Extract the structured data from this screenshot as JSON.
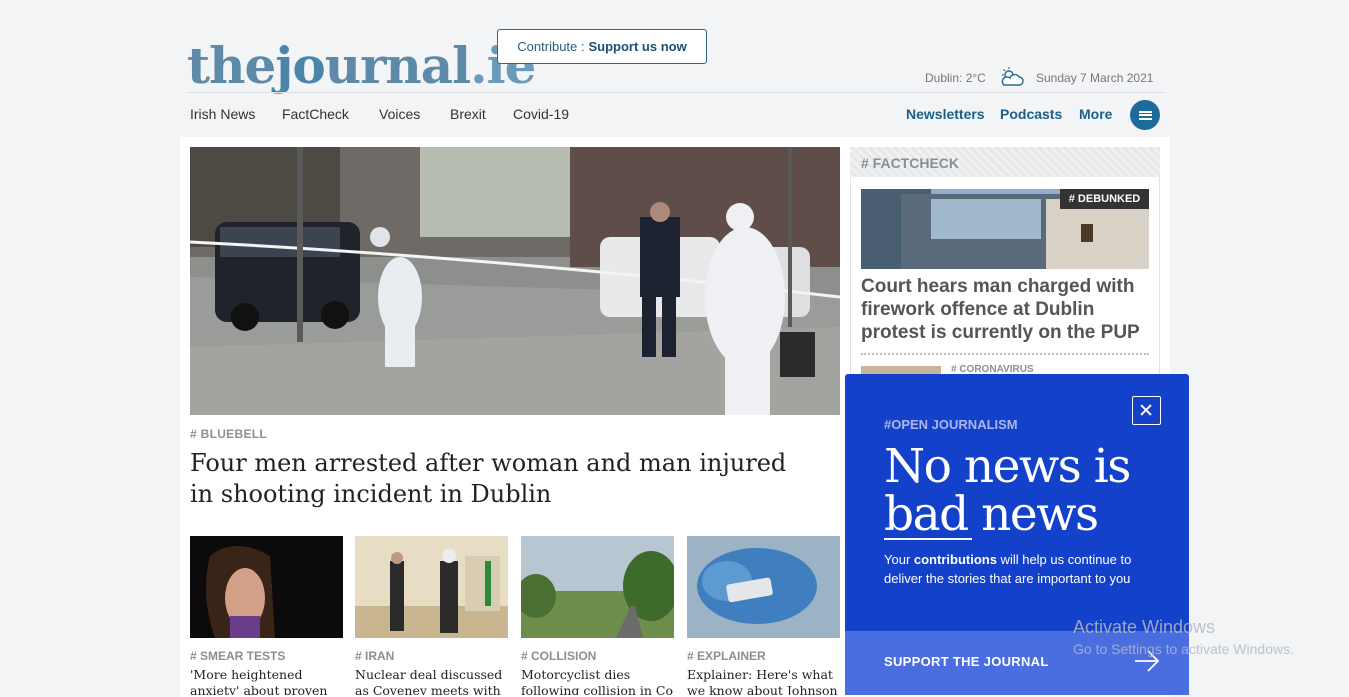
{
  "header": {
    "logo_text_1": "the",
    "logo_text_2": "j",
    "logo_text_3": "urnal",
    "logo_text_4": ".ie",
    "contribute_prefix": "Contribute : ",
    "contribute_cta": "Support us now",
    "weather": "Dublin: 2°C",
    "date": "Sunday 7 March 2021"
  },
  "nav": {
    "left": [
      "Irish News",
      "FactCheck",
      "Voices",
      "Brexit",
      "Covid-19"
    ],
    "right": [
      "Newsletters",
      "Podcasts",
      "More"
    ]
  },
  "main": {
    "tag": "# BLUEBELL",
    "headline": "Four men arrested after woman and man injured in shooting incident in Dublin"
  },
  "thumbs": [
    {
      "tag": "# SMEAR TESTS",
      "title": "'More heightened anxiety' about proven cervical"
    },
    {
      "tag": "# IRAN",
      "title": "Nuclear deal discussed as Coveney meets with"
    },
    {
      "tag": "# COLLISION",
      "title": "Motorcyclist dies following collision in Co Tipperary"
    },
    {
      "tag": "# EXPLAINER",
      "title": "Explainer: Here's what we know about Johnson &"
    }
  ],
  "factcheck": {
    "label": "# FACTCHECK",
    "badge": "# DEBUNKED",
    "title": "Court hears man charged with firework offence at Dublin protest is currently on the PUP",
    "next_tag": "# CORONAVIRUS"
  },
  "popup": {
    "tag": "#OPEN JOURNALISM",
    "big_line1": "No news is",
    "big_line2": "bad news",
    "text_1": "Your ",
    "text_bold": "contributions",
    "text_2": " will help us continue to deliver the stories that are important to you",
    "button": "SUPPORT THE JOURNAL"
  },
  "watermark": {
    "line1": "Activate Windows",
    "line2": "Go to Settings to activate Windows."
  },
  "colors": {
    "brand": "#5d8aa8",
    "accent": "#1d6b9c",
    "popup": "#1441c9"
  }
}
